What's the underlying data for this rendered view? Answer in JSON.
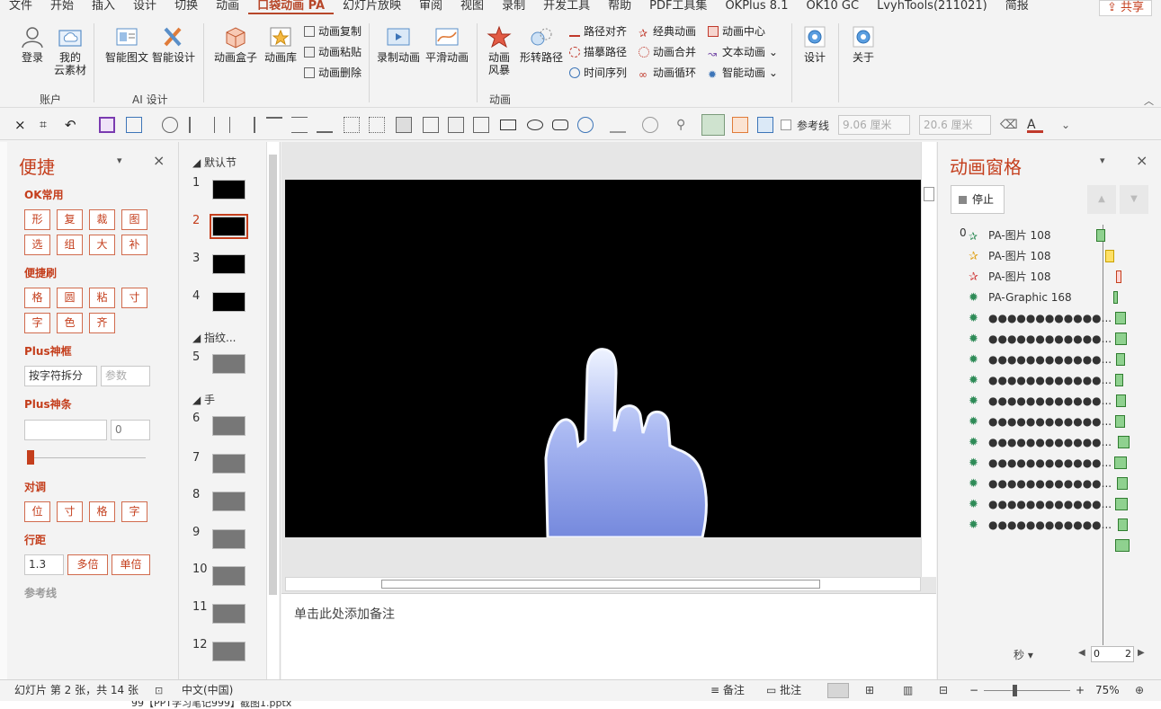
{
  "menu": {
    "tabs": [
      "文件",
      "开始",
      "插入",
      "设计",
      "切换",
      "动画",
      "口袋动画 PA",
      "幻灯片放映",
      "审阅",
      "视图",
      "录制",
      "开发工具",
      "帮助",
      "PDF工具集",
      "OKPlus 8.1",
      "OK10 GC",
      "LvyhTools(211021)",
      "简报"
    ],
    "active_tab": "口袋动画 PA",
    "share_label": "共享"
  },
  "ribbon": {
    "login": "登录",
    "cloud": "我的\n云素材",
    "group_account": "账户",
    "smart_image": "智能图文",
    "smart_design": "智能设计",
    "group_ai": "AI 设计",
    "anim_box": "动画盒子",
    "anim_lib": "动画库",
    "anim_copy": "动画复制",
    "anim_paste": "动画粘贴",
    "anim_delete": "动画删除",
    "record_anim": "录制动画",
    "smooth_anim": "平滑动画",
    "anim_storm": "动画\n风暴",
    "shape_path": "形转路径",
    "path_align": "路径对齐",
    "draw_path": "描摹路径",
    "timeline": "时间序列",
    "classic_anim": "经典动画",
    "anim_merge": "动画合并",
    "anim_loop": "动画循环",
    "anim_center": "动画中心",
    "text_anim": "文本动画",
    "smart_anim": "智能动画",
    "group_anim": "动画",
    "design": "设计",
    "about": "关于"
  },
  "toolbar2": {
    "ref_line_label": "参考线",
    "width_value": "9.06 厘米",
    "height_value": "20.6 厘米"
  },
  "quick_pane": {
    "title": "便捷",
    "ok_common": "OK常用",
    "ok_row1": [
      "形",
      "复",
      "裁",
      "图"
    ],
    "ok_row2": [
      "选",
      "组",
      "大",
      "补"
    ],
    "brush": "便捷刷",
    "brush_row1": [
      "格",
      "圆",
      "粘",
      "寸"
    ],
    "brush_row2": [
      "字",
      "色",
      "齐"
    ],
    "plus_frame": "Plus神框",
    "split_option": "按字符拆分",
    "param_placeholder": "参数",
    "plus_bar": "Plus神条",
    "plus_bar_value": "0",
    "adjust": "对调",
    "adjust_row": [
      "位",
      "寸",
      "格",
      "字"
    ],
    "line_spacing": "行距",
    "spacing_value": "1.3",
    "multi": "多倍",
    "single": "单倍",
    "ref_line": "参考线"
  },
  "thumbnails": {
    "section_default": "默认节",
    "section_fingerprint": "指纹...",
    "section_hand": "手",
    "numbers": [
      "1",
      "2",
      "3",
      "4",
      "5",
      "6",
      "7",
      "8",
      "9",
      "10",
      "11",
      "12"
    ],
    "selected": "2"
  },
  "editor": {
    "notes_placeholder": "单击此处添加备注"
  },
  "anim_pane": {
    "title": "动画窗格",
    "stop": "停止",
    "first_index": "0",
    "items": [
      "PA-图片 108",
      "PA-图片 108",
      "PA-图片 108",
      "PA-Graphic 168",
      "●●●●●●●●●●●●...",
      "●●●●●●●●●●●●...",
      "●●●●●●●●●●●●...",
      "●●●●●●●●●●●●...",
      "●●●●●●●●●●●●...",
      "●●●●●●●●●●●●...",
      "●●●●●●●●●●●●...",
      "●●●●●●●●●●●●...",
      "●●●●●●●●●●●●...",
      "●●●●●●●●●●●●...",
      "●●●●●●●●●●●●..."
    ],
    "seconds": "秒",
    "timeline_start": "0",
    "timeline_end": "2"
  },
  "status": {
    "slide_info": "幻灯片 第 2 张，共 14 张",
    "language": "中文(中国)",
    "notes": "备注",
    "comments": "批注",
    "zoom": "75%"
  },
  "footer_filename": "99【PPT学习笔记999】截图1.pptx",
  "colors": {
    "accent": "#c43e1c",
    "bar_fill": "#8fd18f"
  }
}
